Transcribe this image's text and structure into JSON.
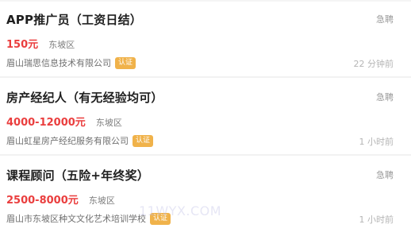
{
  "jobs": [
    {
      "title": "APP推广员（工资日结）",
      "tag": "急聘",
      "salary": "150元",
      "district": "东坡区",
      "company": "眉山瑞思信息技术有限公司",
      "verified_label": "认证",
      "posted": "22 分钟前"
    },
    {
      "title": "房产经纪人（有无经验均可）",
      "tag": "急聘",
      "salary": "4000-12000元",
      "district": "东坡区",
      "company": "眉山虹星房产经纪服务有限公司",
      "verified_label": "认证",
      "posted": "1 小时前"
    },
    {
      "title": "课程顾问（五险+年终奖）",
      "tag": "急聘",
      "salary": "2500-8000元",
      "district": "东坡区",
      "company": "眉山市东坡区种文文化艺术培训学校",
      "verified_label": "认证",
      "posted": "1 小时前"
    }
  ],
  "watermark": "11WYX.COM"
}
